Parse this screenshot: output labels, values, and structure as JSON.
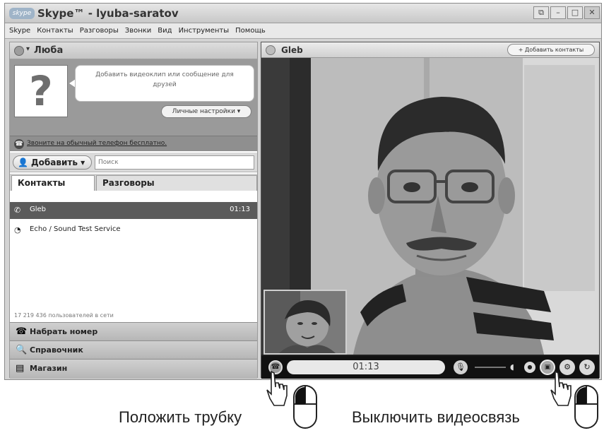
{
  "window": {
    "title": "Skype™ - lyuba-saratov",
    "logo": "skype",
    "controls": [
      "restore",
      "minimize",
      "maximize",
      "close"
    ]
  },
  "menu": [
    "Skype",
    "Контакты",
    "Разговоры",
    "Звонки",
    "Вид",
    "Инструменты",
    "Помощь"
  ],
  "profile": {
    "name": "Люба",
    "avatar_glyph": "?",
    "mood_placeholder": "Добавить видеоклип или сообщение для друзей",
    "personal_settings_label": "Личные настройки ▾"
  },
  "promo": {
    "link": "Звоните на обычный телефон бесплатно."
  },
  "add_row": {
    "add_label": "Добавить ▾",
    "search_placeholder": "Поиск"
  },
  "tabs": {
    "contacts": "Контакты",
    "conversations": "Разговоры"
  },
  "contacts": [
    {
      "name": "Gleb",
      "time": "01:13",
      "active": true
    },
    {
      "name": "Echo / Sound Test Service",
      "time": "",
      "active": false
    }
  ],
  "online_count": "17 219 436 пользователей в сети",
  "side_buttons": {
    "dial": "Набрать номер",
    "directory": "Справочник",
    "shop": "Магазин"
  },
  "call": {
    "contact_name": "Gleb",
    "add_contacts_label": "+ Добавить контакты",
    "timer": "01:13"
  },
  "captions": {
    "hangup": "Положить трубку",
    "video_off": "Выключить видеосвязь"
  },
  "colors": {
    "window_bg": "#d4d4d4",
    "active_row": "#5b5b5b",
    "video_bar": "#111111"
  }
}
